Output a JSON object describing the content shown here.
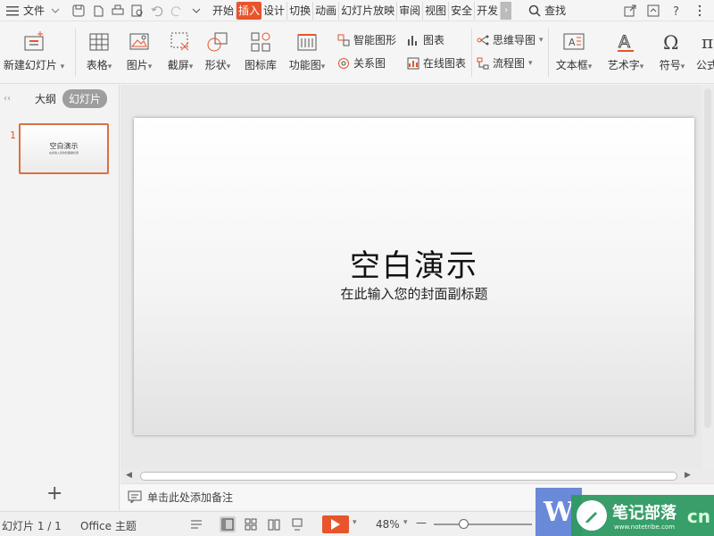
{
  "menubar": {
    "file_label": "文件",
    "tabs": [
      {
        "label": "开始"
      },
      {
        "label": "插入",
        "active": true
      },
      {
        "label": "设计"
      },
      {
        "label": "切换"
      },
      {
        "label": "动画"
      },
      {
        "label": "幻灯片放映"
      },
      {
        "label": "审阅"
      },
      {
        "label": "视图"
      },
      {
        "label": "安全"
      },
      {
        "label": "开发"
      }
    ],
    "more": "›",
    "search_label": "查找"
  },
  "ribbon": {
    "new_slide": "新建幻灯片",
    "table": "表格",
    "picture": "图片",
    "screenshot": "截屏",
    "shape": "形状",
    "icon_lib": "图标库",
    "function_chart": "功能图",
    "smart_shape": "智能图形",
    "chart": "图表",
    "relation": "关系图",
    "online_chart": "在线图表",
    "mind_map": "思维导图",
    "flowchart": "流程图",
    "textbox": "文本框",
    "art_text": "艺术字",
    "symbol": "符号",
    "formula": "公式"
  },
  "left_panel": {
    "tab_outline": "大纲",
    "tab_slides": "幻灯片",
    "slide_number": "1",
    "thumb_title": "空白演示",
    "thumb_sub": "在此输入您的封面副标题",
    "add_slide": "+"
  },
  "slide": {
    "title": "空白演示",
    "subtitle": "在此输入您的封面副标题"
  },
  "notes": {
    "placeholder": "单击此处添加备注"
  },
  "statusbar": {
    "slide_info": "幻灯片 1 / 1",
    "theme": "Office 主题",
    "zoom": "48%",
    "minus": "—"
  },
  "watermark": {
    "w": "W",
    "name": "笔记部落",
    "url": "www.notetribe.com",
    "cn": "cn"
  }
}
